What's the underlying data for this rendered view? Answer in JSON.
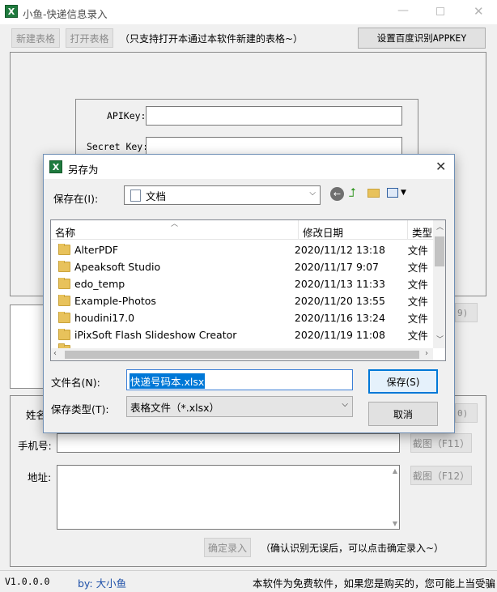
{
  "main": {
    "title": "小鱼-快递信息录入",
    "icon_letter": "X",
    "new_table_button": "新建表格",
    "open_table_button": "打开表格",
    "open_note": "（只支持打开本通过本软件新建的表格~）",
    "set_apikey_button": "设置百度识别APPKEY",
    "apikey_label": "APIKey:",
    "secret_key_label": "Secret Key:",
    "f9_button_partial": "9)",
    "name_label_partial": "姓名",
    "phone_label": "手机号:",
    "address_label": "地址:",
    "f10_button_partial": "0)",
    "screenshot_f11_button": "截图（F11）",
    "screenshot_f12_button": "截图（F12）",
    "confirm_button": "确定录入",
    "confirm_note": "（确认识别无误后，可以点击确定录入~）",
    "version": "V1.0.0.0",
    "author": "by: 大小鱼",
    "footer_note": "本软件为免费软件，如果您是购买的，您可能上当受骗"
  },
  "dialog": {
    "title": "另存为",
    "icon_letter": "X",
    "save_in_label": "保存在(I):",
    "location_value": "文档",
    "columns": {
      "name": "名称",
      "modified": "修改日期",
      "type": "类型"
    },
    "files": [
      {
        "name": "AlterPDF",
        "modified": "2020/11/12 13:18",
        "type": "文件"
      },
      {
        "name": "Apeaksoft Studio",
        "modified": "2020/11/17 9:07",
        "type": "文件"
      },
      {
        "name": "edo_temp",
        "modified": "2020/11/13 11:33",
        "type": "文件"
      },
      {
        "name": "Example-Photos",
        "modified": "2020/11/20 13:55",
        "type": "文件"
      },
      {
        "name": "houdini17.0",
        "modified": "2020/11/16 13:24",
        "type": "文件"
      },
      {
        "name": "iPixSoft Flash Slideshow Creator",
        "modified": "2020/11/19 11:08",
        "type": "文件"
      }
    ],
    "filename_label": "文件名(N):",
    "filename_value": "快递号码本.xlsx",
    "filetype_label": "保存类型(T):",
    "filetype_value": "表格文件（*.xlsx）",
    "save_button": "保存(S)",
    "cancel_button": "取消"
  }
}
